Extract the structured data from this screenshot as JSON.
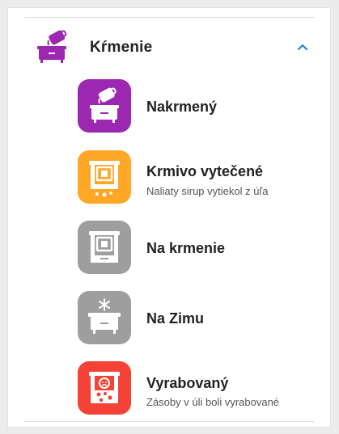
{
  "section": {
    "title": "Kŕmenie",
    "icon": "feeding-hive-icon",
    "expanded": true,
    "chevron_icon": "chevron-up-icon",
    "accent_color": "#1e88e5",
    "icon_color": "#9c27b0"
  },
  "items": [
    {
      "title": "Nakrmený",
      "subtitle": "",
      "icon": "fed-hive-icon",
      "color": "#9c27b0"
    },
    {
      "title": "Krmivo vytečené",
      "subtitle": "Naliaty sirup vytiekol z úľa",
      "icon": "feeder-leak-icon",
      "color": "#ffa726"
    },
    {
      "title": "Na krmenie",
      "subtitle": "",
      "icon": "feeder-hive-icon",
      "color": "#9e9e9e"
    },
    {
      "title": "Na Zimu",
      "subtitle": "",
      "icon": "winter-hive-icon",
      "color": "#9e9e9e"
    },
    {
      "title": "Vyrabovaný",
      "subtitle": "Zásoby v úli boli vyrabované",
      "icon": "robbed-hive-icon",
      "color": "#f44336"
    }
  ]
}
